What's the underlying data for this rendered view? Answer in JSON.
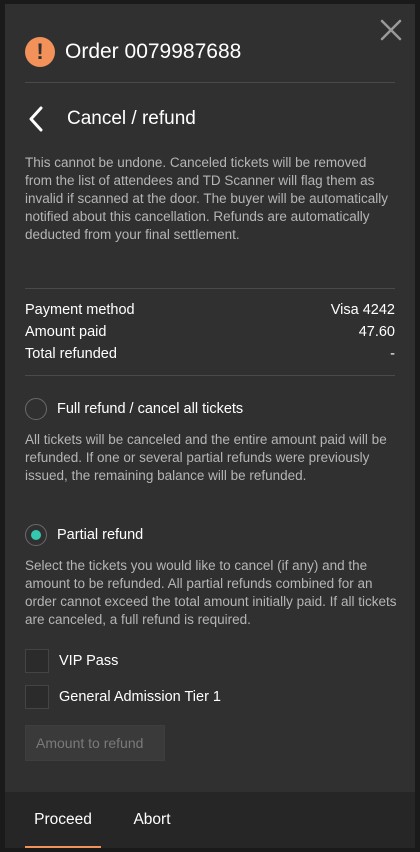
{
  "header": {
    "order_title": "Order 0079987688",
    "alert_icon": "!"
  },
  "subheader": {
    "title": "Cancel / refund"
  },
  "description": "This cannot be undone. Canceled tickets will be removed from the list of attendees and TD Scanner will flag them as invalid if scanned at the door. The buyer will be automatically notified about this cancellation. Refunds are automatically deducted from your final settlement.",
  "summary": {
    "payment_method_label": "Payment method",
    "payment_method_value": "Visa 4242",
    "amount_paid_label": "Amount paid",
    "amount_paid_value": "47.60",
    "total_refunded_label": "Total refunded",
    "total_refunded_value": "-"
  },
  "options": {
    "full_refund_label": "Full refund / cancel all tickets",
    "full_refund_help": "All tickets will be canceled and the entire amount paid will be refunded. If one or several partial refunds were previously issued, the remaining balance will be refunded.",
    "partial_refund_label": "Partial refund",
    "partial_refund_help": "Select the tickets you would like to cancel (if any) and the amount to be refunded. All partial refunds combined for an order cannot exceed the total amount initially paid. If all tickets are canceled, a full refund is required.",
    "selected": "partial"
  },
  "tickets": [
    {
      "label": "VIP Pass",
      "checked": false
    },
    {
      "label": "General Admission Tier 1",
      "checked": false
    }
  ],
  "amount_input": {
    "placeholder": "Amount to refund",
    "value": ""
  },
  "footer": {
    "proceed_label": "Proceed",
    "abort_label": "Abort"
  },
  "colors": {
    "accent": "#f2925a",
    "radio_selected": "#35c8b0",
    "panel": "#303030"
  },
  "icons": {
    "close": "close-icon",
    "back": "chevron-left-icon",
    "alert": "alert-circle-icon"
  }
}
